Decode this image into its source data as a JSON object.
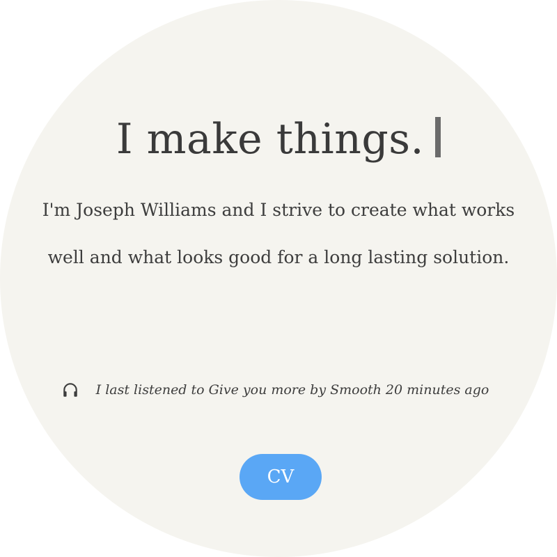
{
  "hero": {
    "headline": "I make things.",
    "intro": "I'm Joseph Williams and I strive to create what works well and what looks good for a long lasting solution."
  },
  "now_playing": {
    "icon": "headphones-icon",
    "text": "I last listened to Give you more by Smooth 20 minutes ago"
  },
  "cv_button": {
    "label": "CV",
    "color": "#5aa7f5"
  },
  "colors": {
    "background": "#f5f4ef",
    "text": "#3a3a3a"
  }
}
